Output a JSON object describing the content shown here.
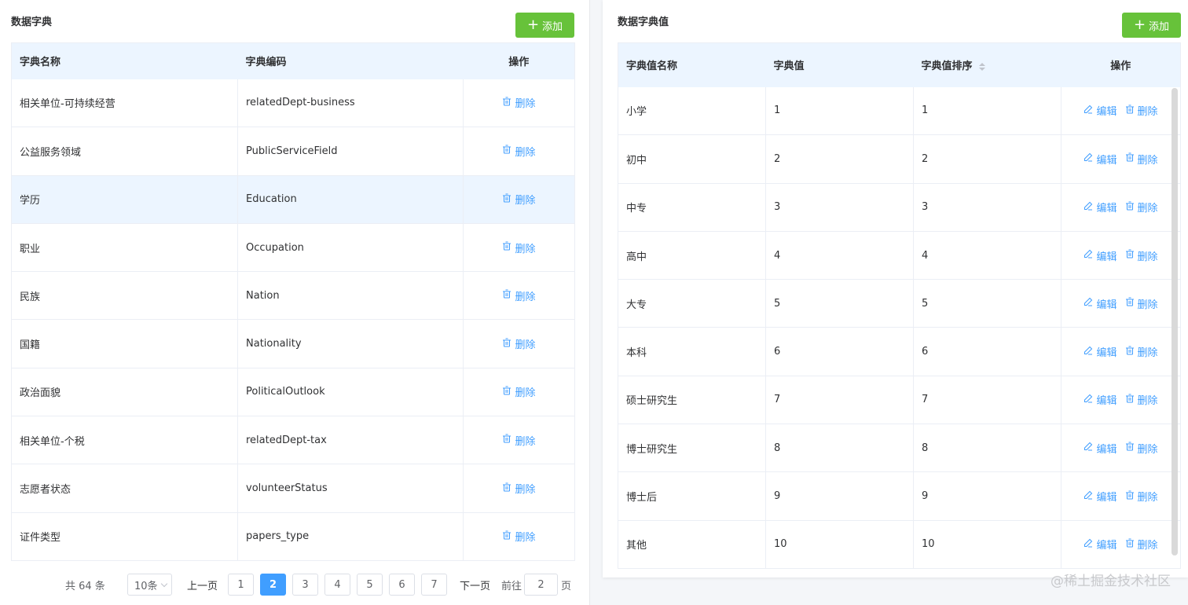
{
  "left": {
    "title": "数据字典",
    "add_label": "添加",
    "columns": [
      "字典名称",
      "字典编码",
      "操作"
    ],
    "delete_label": "删除",
    "rows": [
      {
        "name": "相关单位-可持续经营",
        "code": "relatedDept-business"
      },
      {
        "name": "公益服务领域",
        "code": "PublicServiceField"
      },
      {
        "name": "学历",
        "code": "Education"
      },
      {
        "name": "职业",
        "code": "Occupation"
      },
      {
        "name": "民族",
        "code": "Nation"
      },
      {
        "name": "国籍",
        "code": "Nationality"
      },
      {
        "name": "政治面貌",
        "code": "PoliticalOutlook"
      },
      {
        "name": "相关单位-个税",
        "code": "relatedDept-tax"
      },
      {
        "name": "志愿者状态",
        "code": "volunteerStatus"
      },
      {
        "name": "证件类型",
        "code": "papers_type"
      }
    ],
    "highlight_row": 2
  },
  "right": {
    "title": "数据字典值",
    "add_label": "添加",
    "columns": [
      "字典值名称",
      "字典值",
      "字典值排序",
      "操作"
    ],
    "edit_label": "编辑",
    "delete_label": "删除",
    "rows": [
      {
        "name": "小学",
        "value": "1",
        "order": "1"
      },
      {
        "name": "初中",
        "value": "2",
        "order": "2"
      },
      {
        "name": "中专",
        "value": "3",
        "order": "3"
      },
      {
        "name": "高中",
        "value": "4",
        "order": "4"
      },
      {
        "name": "大专",
        "value": "5",
        "order": "5"
      },
      {
        "name": "本科",
        "value": "6",
        "order": "6"
      },
      {
        "name": "硕士研究生",
        "value": "7",
        "order": "7"
      },
      {
        "name": "博士研究生",
        "value": "8",
        "order": "8"
      },
      {
        "name": "博士后",
        "value": "9",
        "order": "9"
      },
      {
        "name": "其他",
        "value": "10",
        "order": "10"
      }
    ]
  },
  "pager": {
    "total": "共 64 条",
    "size": "10条",
    "prev": "上一页",
    "next": "下一页",
    "pages": [
      "1",
      "2",
      "3",
      "4",
      "5",
      "6",
      "7"
    ],
    "current": "2",
    "goto": "前往",
    "goto_value": "2",
    "page_suffix": "页"
  },
  "watermark": "@稀土掘金技术社区",
  "colors": {
    "accent": "#409eff",
    "add_button": "#67c23a",
    "header_bg": "#ecf5ff"
  }
}
